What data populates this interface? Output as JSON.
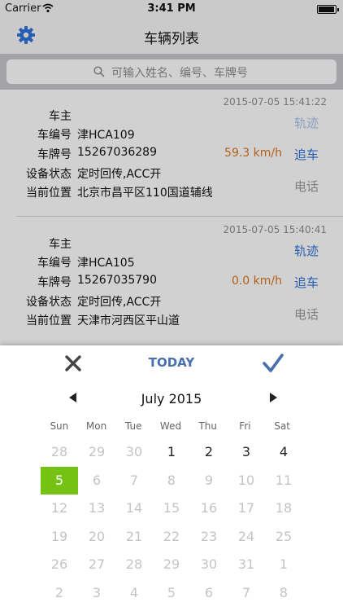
{
  "status_bar": {
    "carrier": "Carrier",
    "time": "3:41 PM"
  },
  "nav": {
    "title": "车辆列表",
    "settings_icon": "gear-icon"
  },
  "search": {
    "placeholder": "可输入姓名、编号、车牌号"
  },
  "vehicles": [
    {
      "timestamp": "2015-07-05 15:41:22",
      "owner_label": "车主",
      "owner": "",
      "number_label": "车编号",
      "number": "津HCA109",
      "plate_label": "车牌号",
      "plate": "15267036289",
      "status_label": "设备状态",
      "status": "定时回传,ACC开",
      "location_label": "当前位置",
      "location": "北京市昌平区110国道辅线",
      "speed": "59.3 km/h",
      "track_label": "轨迹",
      "follow_label": "追车",
      "phone_label": "电话"
    },
    {
      "timestamp": "2015-07-05 15:40:41",
      "owner_label": "车主",
      "owner": "",
      "number_label": "车编号",
      "number": "津HCA105",
      "plate_label": "车牌号",
      "plate": "15267035790",
      "status_label": "设备状态",
      "status": "定时回传,ACC开",
      "location_label": "当前位置",
      "location": "天津市河西区平山道",
      "speed": "0.0 km/h",
      "track_label": "轨迹",
      "follow_label": "追车",
      "phone_label": "电话"
    }
  ],
  "calendar": {
    "today_label": "TODAY",
    "month_label": "July 2015",
    "weekdays": [
      "Sun",
      "Mon",
      "Tue",
      "Wed",
      "Thu",
      "Fri",
      "Sat"
    ],
    "selected": "5",
    "weeks": [
      [
        {
          "d": "28",
          "m": "prev"
        },
        {
          "d": "29",
          "m": "prev"
        },
        {
          "d": "30",
          "m": "prev"
        },
        {
          "d": "1",
          "m": "cur"
        },
        {
          "d": "2",
          "m": "cur"
        },
        {
          "d": "3",
          "m": "cur"
        },
        {
          "d": "4",
          "m": "cur"
        }
      ],
      [
        {
          "d": "5",
          "m": "sel"
        },
        {
          "d": "6",
          "m": "dim"
        },
        {
          "d": "7",
          "m": "dim"
        },
        {
          "d": "8",
          "m": "dim"
        },
        {
          "d": "9",
          "m": "dim"
        },
        {
          "d": "10",
          "m": "dim"
        },
        {
          "d": "11",
          "m": "dim"
        }
      ],
      [
        {
          "d": "12",
          "m": "dim"
        },
        {
          "d": "13",
          "m": "dim"
        },
        {
          "d": "14",
          "m": "dim"
        },
        {
          "d": "15",
          "m": "dim"
        },
        {
          "d": "16",
          "m": "dim"
        },
        {
          "d": "17",
          "m": "dim"
        },
        {
          "d": "18",
          "m": "dim"
        }
      ],
      [
        {
          "d": "19",
          "m": "dim"
        },
        {
          "d": "20",
          "m": "dim"
        },
        {
          "d": "21",
          "m": "dim"
        },
        {
          "d": "22",
          "m": "dim"
        },
        {
          "d": "23",
          "m": "dim"
        },
        {
          "d": "24",
          "m": "dim"
        },
        {
          "d": "25",
          "m": "dim"
        }
      ],
      [
        {
          "d": "26",
          "m": "dim"
        },
        {
          "d": "27",
          "m": "dim"
        },
        {
          "d": "28",
          "m": "dim"
        },
        {
          "d": "29",
          "m": "dim"
        },
        {
          "d": "30",
          "m": "dim"
        },
        {
          "d": "31",
          "m": "dim"
        },
        {
          "d": "1",
          "m": "dim"
        }
      ],
      [
        {
          "d": "2",
          "m": "dim"
        },
        {
          "d": "3",
          "m": "dim"
        },
        {
          "d": "4",
          "m": "dim"
        },
        {
          "d": "5",
          "m": "dim"
        },
        {
          "d": "6",
          "m": "dim"
        },
        {
          "d": "7",
          "m": "dim"
        },
        {
          "d": "8",
          "m": "dim"
        }
      ]
    ]
  },
  "colors": {
    "accent": "#2f73d8",
    "speed": "#d9771f",
    "selected_day": "#74c312",
    "today": "#4a6fae"
  }
}
